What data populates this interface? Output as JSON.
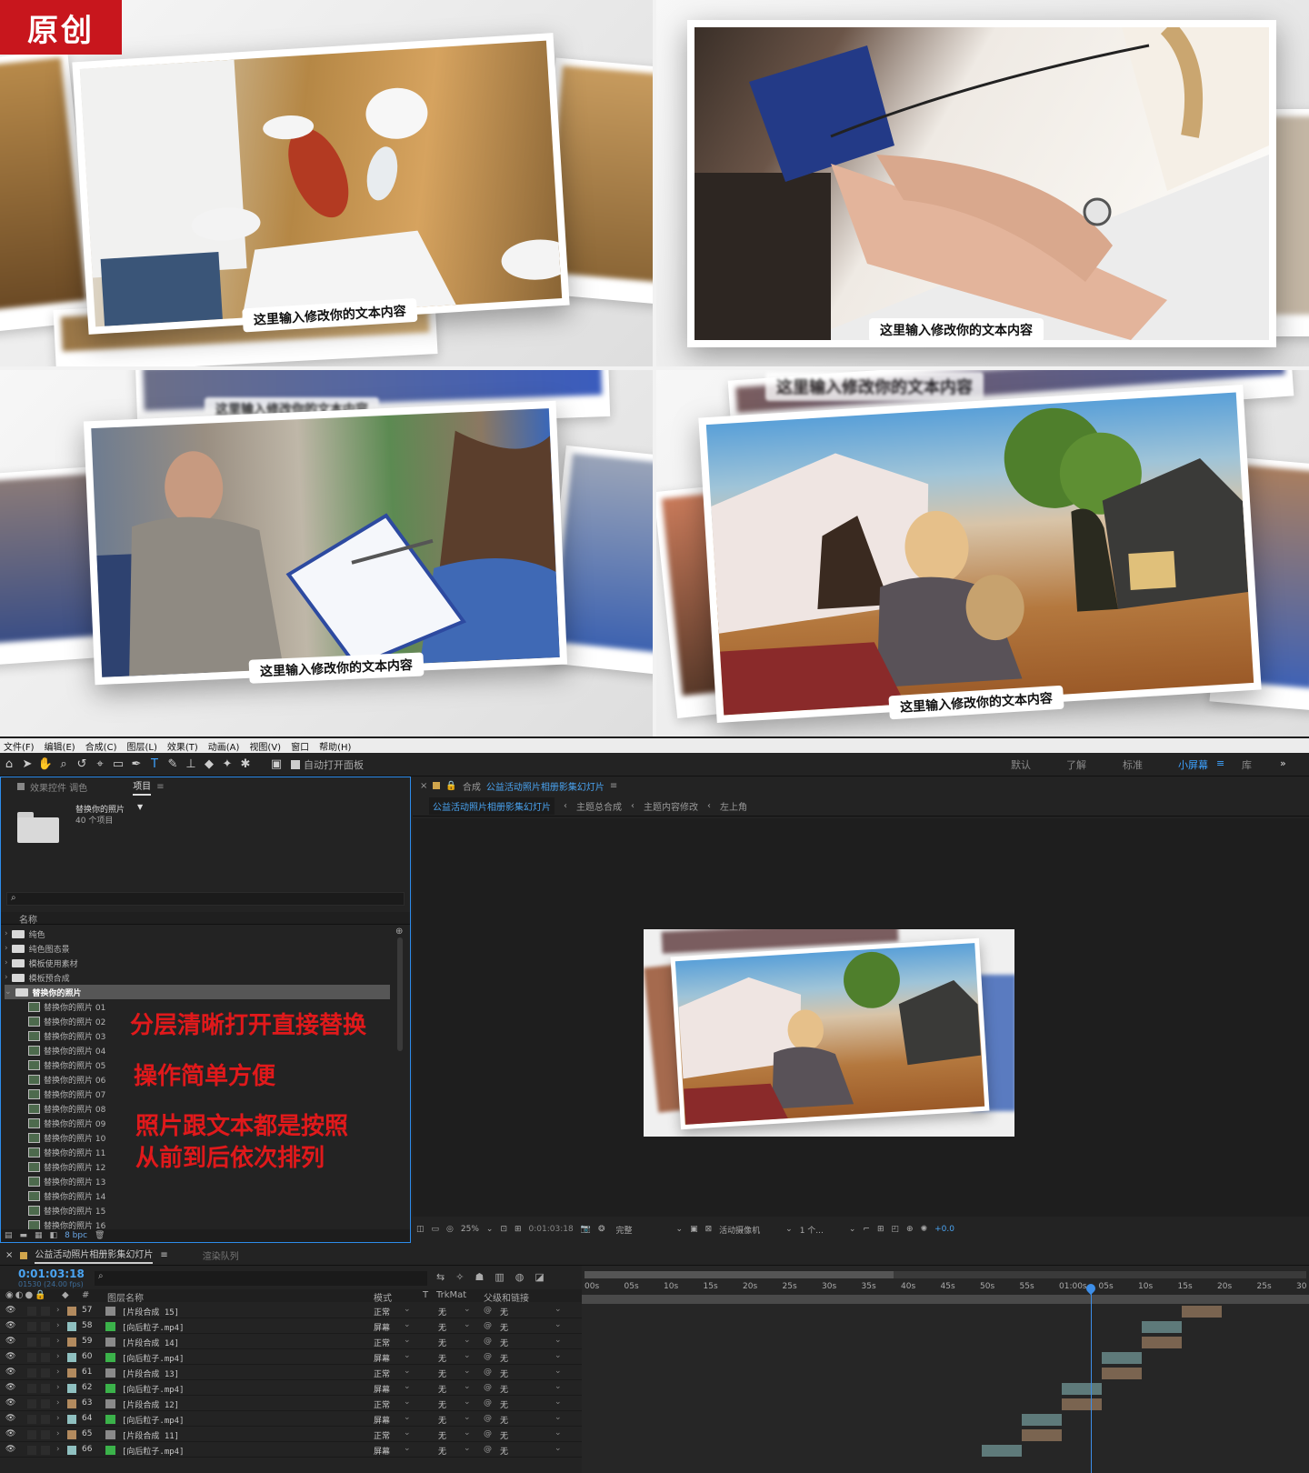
{
  "badge": "原创",
  "captions": [
    "这里输入修改你的文本内容",
    "这里输入修改你的文本内容",
    "这里输入修改你的文本内容",
    "这里输入修改你的文本内容"
  ],
  "menu": [
    "文件(F)",
    "编辑(E)",
    "合成(C)",
    "图层(L)",
    "效果(T)",
    "动画(A)",
    "视图(V)",
    "窗口",
    "帮助(H)"
  ],
  "toolbar": {
    "auto_open": "自动打开面板",
    "workspaces": [
      "默认",
      "了解",
      "标准",
      "小屏幕",
      "库"
    ]
  },
  "project": {
    "tabs": [
      "效果控件 调色",
      "项目"
    ],
    "folder_name": "替换你的照片",
    "item_count": "40 个项目",
    "name_header": "名称",
    "folders": [
      "纯色",
      "纯色图态景",
      "模板使用素材",
      "模板预合成",
      "替换你的照片"
    ],
    "items": [
      "替换你的照片 01",
      "替换你的照片 02",
      "替换你的照片 03",
      "替换你的照片 04",
      "替换你的照片 05",
      "替换你的照片 06",
      "替换你的照片 07",
      "替换你的照片 08",
      "替换你的照片 09",
      "替换你的照片 10",
      "替换你的照片 11",
      "替换你的照片 12",
      "替换你的照片 13",
      "替换你的照片 14",
      "替换你的照片 15",
      "替换你的照片 16"
    ],
    "bpc": "8 bpc"
  },
  "notes": [
    "分层清晰打开直接替换",
    "操作简单方便",
    "照片跟文本都是按照",
    "从前到后依次排列"
  ],
  "comp": {
    "tab_label": "合成",
    "tab_name": "公益活动照片相册影集幻灯片",
    "breadcrumbs": [
      "公益活动照片相册影集幻灯片",
      "主题总合成",
      "主题内容修改",
      "左上角"
    ],
    "zoom": "25%",
    "timecode": "0:01:03:18",
    "quality": "完整",
    "camera": "活动摄像机",
    "views": "1 个...",
    "offset": "+0.0"
  },
  "timeline": {
    "tab_name": "公益活动照片相册影集幻灯片",
    "render_queue": "渲染队列",
    "timecode": "0:01:03:18",
    "frame_info": "01530 (24.00 fps)",
    "headers": {
      "name": "图层名称",
      "mode": "模式",
      "t": "T",
      "trkmat": "TrkMat",
      "parent": "父级和链接"
    },
    "ruler": [
      "00s",
      "05s",
      "10s",
      "15s",
      "20s",
      "25s",
      "30s",
      "35s",
      "40s",
      "45s",
      "50s",
      "55s",
      "01:00s",
      "05s",
      "10s",
      "15s",
      "20s",
      "25s",
      "30"
    ],
    "layers": [
      {
        "num": "57",
        "name": "[片段合成 15]",
        "mode": "正常",
        "trk": "无",
        "parent": "无"
      },
      {
        "num": "58",
        "name": "[向后粒子.mp4]",
        "mode": "屏幕",
        "trk": "无",
        "parent": "无"
      },
      {
        "num": "59",
        "name": "[片段合成 14]",
        "mode": "正常",
        "trk": "无",
        "parent": "无"
      },
      {
        "num": "60",
        "name": "[向后粒子.mp4]",
        "mode": "屏幕",
        "trk": "无",
        "parent": "无"
      },
      {
        "num": "61",
        "name": "[片段合成 13]",
        "mode": "正常",
        "trk": "无",
        "parent": "无"
      },
      {
        "num": "62",
        "name": "[向后粒子.mp4]",
        "mode": "屏幕",
        "trk": "无",
        "parent": "无"
      },
      {
        "num": "63",
        "name": "[片段合成 12]",
        "mode": "正常",
        "trk": "无",
        "parent": "无"
      },
      {
        "num": "64",
        "name": "[向后粒子.mp4]",
        "mode": "屏幕",
        "trk": "无",
        "parent": "无"
      },
      {
        "num": "65",
        "name": "[片段合成 11]",
        "mode": "正常",
        "trk": "无",
        "parent": "无"
      },
      {
        "num": "66",
        "name": "[向后粒子.mp4]",
        "mode": "屏幕",
        "trk": "无",
        "parent": "无"
      }
    ]
  }
}
